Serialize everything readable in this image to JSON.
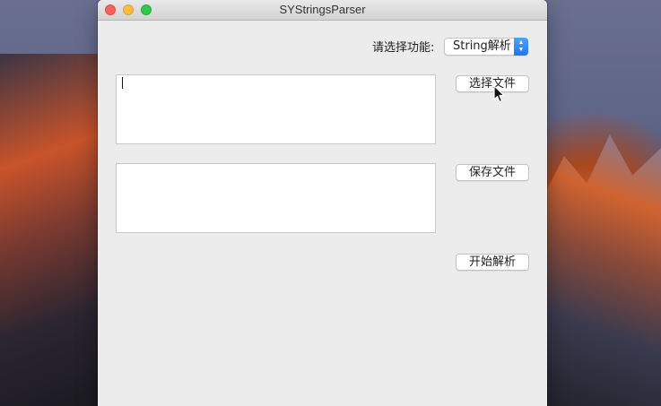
{
  "window": {
    "title": "SYStringsParser"
  },
  "function_selector": {
    "label": "请选择功能:",
    "selected": "String解析"
  },
  "input_area": {
    "value": ""
  },
  "output_area": {
    "value": ""
  },
  "buttons": {
    "choose_file": "选择文件",
    "save_file": "保存文件",
    "start_parse": "开始解析"
  },
  "colors": {
    "close": "#fc605c",
    "minimize": "#fdbc40",
    "zoom": "#34c84a",
    "popup_accent": "#1d76f2"
  },
  "icons": {
    "popup_arrows": "up-down-chevron-icon",
    "cursor": "mouse-pointer-icon"
  }
}
